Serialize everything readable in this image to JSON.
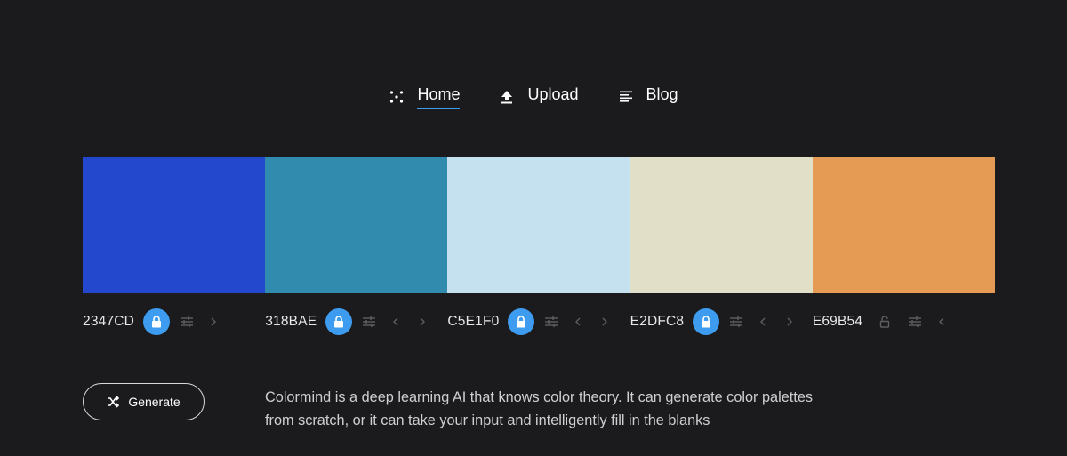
{
  "nav": {
    "items": [
      {
        "label": "Home",
        "icon": "dots-icon",
        "active": true
      },
      {
        "label": "Upload",
        "icon": "upload-icon",
        "active": false
      },
      {
        "label": "Blog",
        "icon": "text-lines-icon",
        "active": false
      }
    ]
  },
  "palette": {
    "colors": [
      {
        "hex": "2347CD",
        "color": "#2347CD",
        "locked": true
      },
      {
        "hex": "318BAE",
        "color": "#318BAE",
        "locked": true
      },
      {
        "hex": "C5E1F0",
        "color": "#C5E1F0",
        "locked": true
      },
      {
        "hex": "E2DFC8",
        "color": "#E2DFC8",
        "locked": true
      },
      {
        "hex": "E69B54",
        "color": "#E69B54",
        "locked": false
      }
    ]
  },
  "generate": {
    "label": "Generate",
    "icon": "shuffle-icon"
  },
  "description": "Colormind is a deep learning AI that knows color theory. It can generate color palettes from scratch, or it can take your input and intelligently fill in the blanks",
  "theme": {
    "accent": "#3d9bf0",
    "background": "#1b1b1d"
  }
}
